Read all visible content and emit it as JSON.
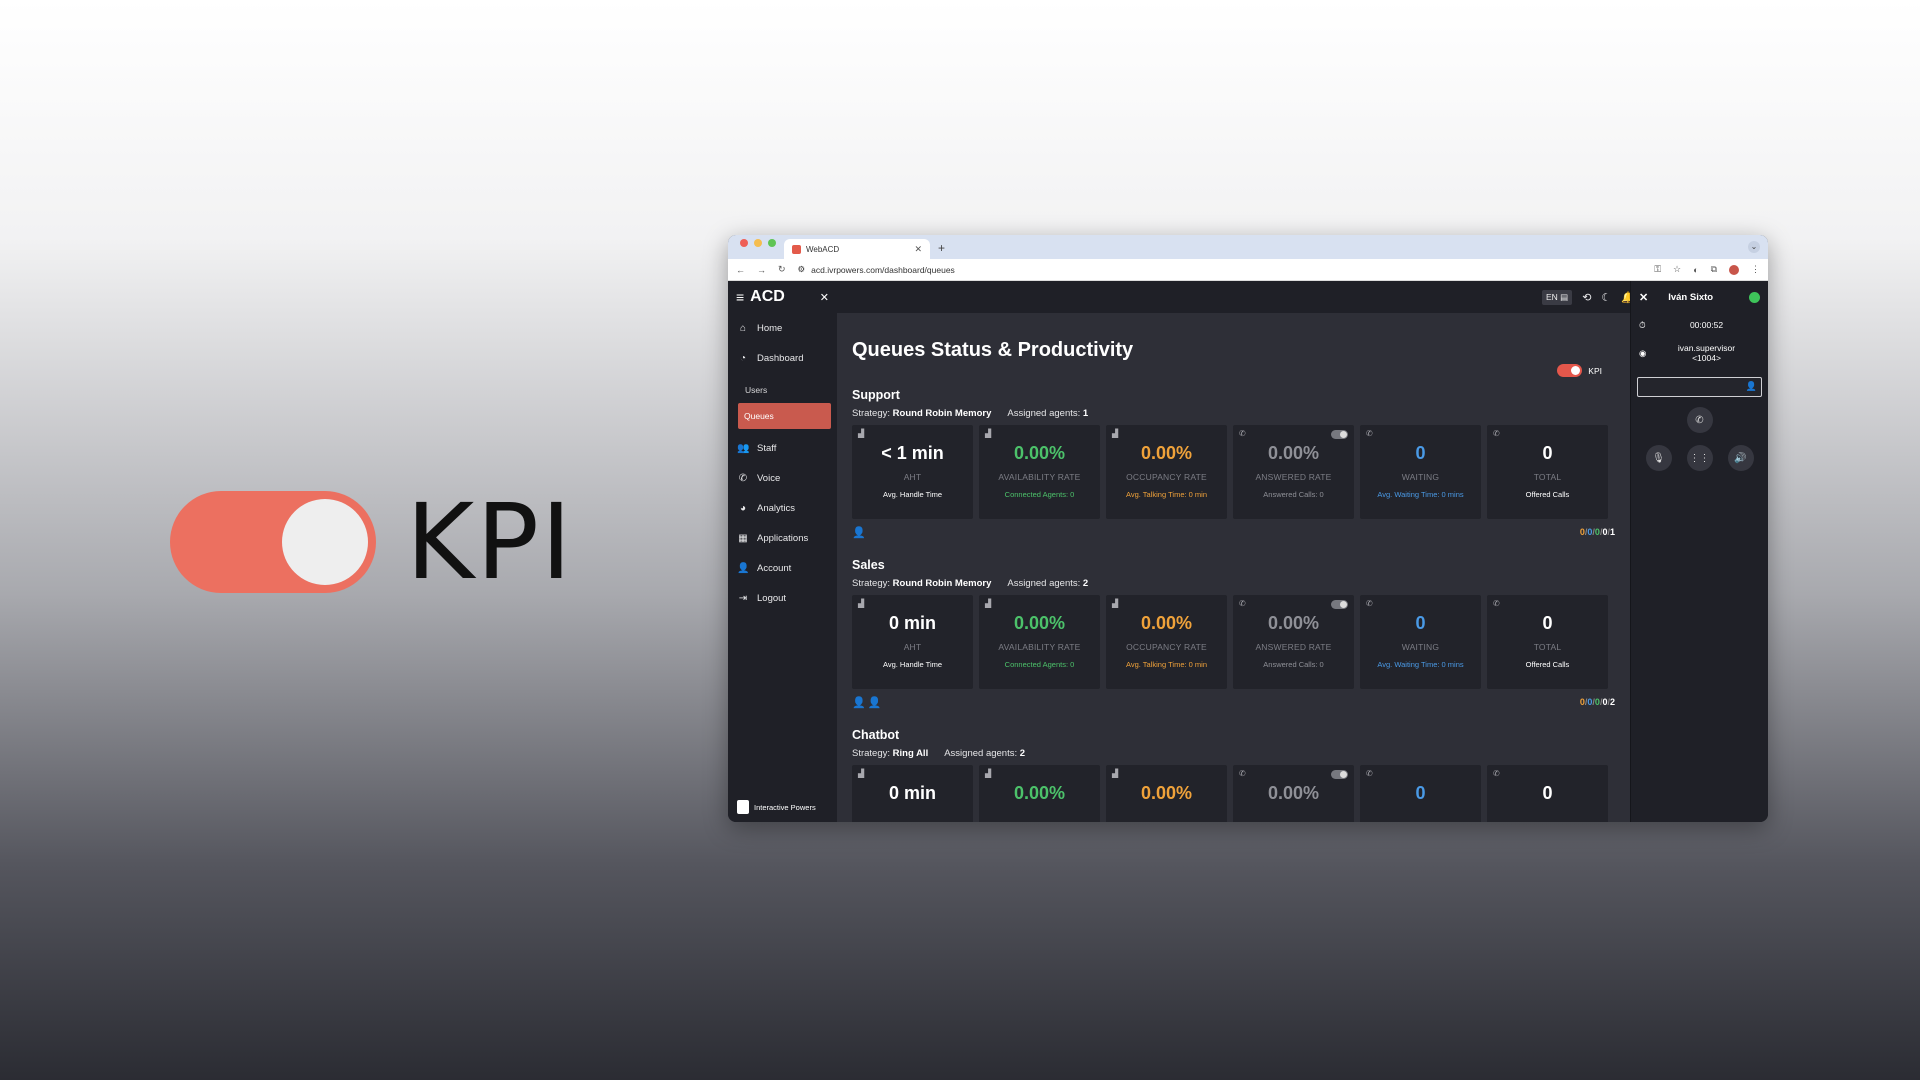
{
  "promo": {
    "label": "KPI"
  },
  "browser": {
    "tab_title": "WebACD",
    "url": "acd.ivrpowers.com/dashboard/queues"
  },
  "app": {
    "brand": "ACD",
    "language": "EN",
    "user_name": "Iván Sixto",
    "timer": "00:00:52",
    "account": "ivan.supervisor",
    "extension": "<1004>"
  },
  "sidebar": {
    "items": [
      {
        "label": "Home"
      },
      {
        "label": "Dashboard"
      },
      {
        "label": "Users"
      },
      {
        "label": "Queues"
      },
      {
        "label": "Staff"
      },
      {
        "label": "Voice"
      },
      {
        "label": "Analytics"
      },
      {
        "label": "Applications"
      },
      {
        "label": "Account"
      },
      {
        "label": "Logout"
      }
    ],
    "footer": "Interactive Powers"
  },
  "main": {
    "title": "Queues Status & Productivity",
    "kpi_toggle_label": "KPI",
    "strategy_label": "Strategy:",
    "assigned_label": "Assigned agents:",
    "queues": [
      {
        "name": "Support",
        "strategy": "Round Robin Memory",
        "assigned": "1",
        "cards": [
          {
            "value": "< 1 min",
            "label": "AHT",
            "sub": "Avg. Handle Time"
          },
          {
            "value": "0.00%",
            "label": "AVAILABILITY RATE",
            "sub": "Connected Agents: 0"
          },
          {
            "value": "0.00%",
            "label": "OCCUPANCY RATE",
            "sub": "Avg. Talking Time: 0 min"
          },
          {
            "value": "0.00%",
            "label": "ANSWERED RATE",
            "sub": "Answered Calls: 0"
          },
          {
            "value": "0",
            "label": "WAITING",
            "sub": "Avg. Waiting Time: 0 mins"
          },
          {
            "value": "0",
            "label": "TOTAL",
            "sub": "Offered Calls"
          }
        ],
        "counts": [
          "0",
          "0",
          "0",
          "0",
          "1"
        ]
      },
      {
        "name": "Sales",
        "strategy": "Round Robin Memory",
        "assigned": "2",
        "cards": [
          {
            "value": "0 min",
            "label": "AHT",
            "sub": "Avg. Handle Time"
          },
          {
            "value": "0.00%",
            "label": "AVAILABILITY RATE",
            "sub": "Connected Agents: 0"
          },
          {
            "value": "0.00%",
            "label": "OCCUPANCY RATE",
            "sub": "Avg. Talking Time: 0 min"
          },
          {
            "value": "0.00%",
            "label": "ANSWERED RATE",
            "sub": "Answered Calls: 0"
          },
          {
            "value": "0",
            "label": "WAITING",
            "sub": "Avg. Waiting Time: 0 mins"
          },
          {
            "value": "0",
            "label": "TOTAL",
            "sub": "Offered Calls"
          }
        ],
        "counts": [
          "0",
          "0",
          "0",
          "0",
          "2"
        ]
      },
      {
        "name": "Chatbot",
        "strategy": "Ring All",
        "assigned": "2",
        "cards": [
          {
            "value": "0 min"
          },
          {
            "value": "0.00%"
          },
          {
            "value": "0.00%"
          },
          {
            "value": "0.00%"
          },
          {
            "value": "0"
          },
          {
            "value": "0"
          }
        ]
      }
    ]
  },
  "colors": {
    "accent": "#e4574b",
    "green": "#4cc26a",
    "orange": "#f0a23a",
    "blue": "#4a9ae6",
    "online": "#3ec45a"
  },
  "icons": [
    "menu-icon",
    "home-icon",
    "dashboard-icon",
    "staff-icon",
    "phone-icon",
    "analytics-icon",
    "apps-icon",
    "user-icon",
    "logout-icon",
    "history-icon",
    "moon-icon",
    "bell-icon",
    "timer-icon",
    "account-icon",
    "mic-icon",
    "keypad-icon",
    "speaker-icon",
    "chart-icon"
  ]
}
